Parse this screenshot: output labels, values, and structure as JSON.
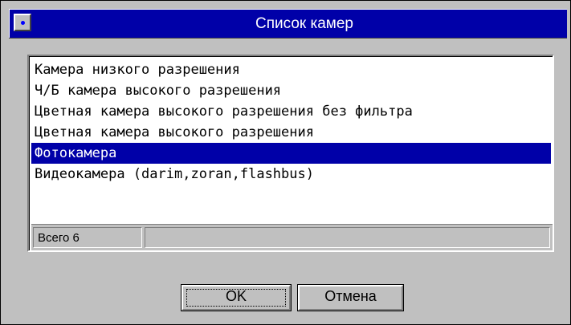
{
  "window": {
    "title": "Список камер"
  },
  "list": {
    "items": [
      {
        "label": "Камера низкого разрешения"
      },
      {
        "label": "Ч/Б камера высокого разрешения"
      },
      {
        "label": "Цветная камера высокого разрешения без фильтра"
      },
      {
        "label": "Цветная камера высокого разрешения"
      },
      {
        "label": "Фотокамера"
      },
      {
        "label": "Видеокамера (darim,zoran,flashbus)"
      }
    ],
    "selected_index": 4
  },
  "status": {
    "total_label": "Всего 6",
    "extra": ""
  },
  "buttons": {
    "ok_label": "OK",
    "cancel_label": "Отмена"
  },
  "colors": {
    "titlebar": "#0000a8",
    "selection": "#0000a8",
    "face": "#c0c0c0"
  }
}
